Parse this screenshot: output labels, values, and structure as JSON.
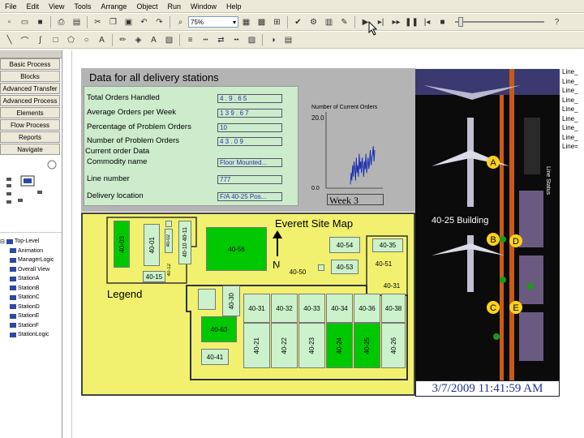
{
  "menu": [
    "File",
    "Edit",
    "View",
    "Tools",
    "Arrange",
    "Object",
    "Run",
    "Window",
    "Help"
  ],
  "toolbar": {
    "zoom_value": "75%"
  },
  "nav_buttons": [
    "Basic Process",
    "Blocks",
    "Advanced Transfer",
    "Advanced Process",
    "Elements",
    "Flow Process",
    "Reports",
    "Navigate"
  ],
  "tree": [
    "Top-Level",
    "Animation",
    "ManagerLogic",
    "Overall View",
    "StationA",
    "StationB",
    "StationC",
    "StationD",
    "StationE",
    "StationF",
    "StationLogic"
  ],
  "panel": {
    "title": "Data for all delivery stations",
    "labels": {
      "total": "Total Orders Handled",
      "avg": "Average Orders per Week",
      "pct": "Percentage of Problem Orders",
      "num": "Number of Problem Orders",
      "current": "Current order Data",
      "commodity": "Commodity name",
      "line": "Line number",
      "location": "Delivery location"
    },
    "values": {
      "total": "4 . 9 . 6 5",
      "avg": "1 3 9 . 6 7",
      "pct": "10",
      "num": "4 3 . 0 9",
      "commodity": "Floor Mounted...",
      "line": "777",
      "location": "F/A 40-25 Pos..."
    }
  },
  "chart": {
    "title": "Number of Current Orders",
    "ymax": "20.0",
    "ymin": "0.0",
    "week_label": "Week 3"
  },
  "chart_data": {
    "type": "line",
    "title": "Number of Current Orders",
    "ylim": [
      0,
      20
    ],
    "values": [
      1,
      4,
      2,
      6,
      3,
      7,
      5,
      2,
      8,
      4,
      6,
      3,
      9,
      5,
      7,
      4,
      8,
      6,
      3,
      7,
      5,
      9,
      4,
      6,
      8,
      5,
      7,
      10,
      6,
      8,
      9,
      11,
      7,
      10
    ]
  },
  "map": {
    "title": "Everett Site Map",
    "north": "N",
    "legend": "Legend",
    "buildings": {
      "b4003": "40-03",
      "b4001": "40-01",
      "b4002": "40-02",
      "b4010": "40-10 40-11",
      "b4012": "40-12",
      "b4015": "40-15",
      "b4056": "40-56",
      "b4054": "40-54",
      "b4035": "40-35",
      "b4053": "40-53",
      "b4051": "40-51",
      "b4050": "40-50",
      "b4031t": "40-31",
      "b4030": "40-30",
      "b4031": "40-31",
      "b4032": "40-32",
      "b4033": "40-33",
      "b4034": "40-34",
      "b4036": "40-36",
      "b4038": "40-38",
      "b4063": "40-63",
      "b4021": "40-21",
      "b4022": "40-22",
      "b4023": "40-23",
      "b4024": "40-24",
      "b4025": "40-25",
      "b4026": "40-26",
      "b4041": "40-41"
    }
  },
  "satellite": {
    "building_label": "40-25 Building",
    "stations": [
      "A",
      "B",
      "D",
      "C",
      "E"
    ],
    "side_text": "Line Status"
  },
  "timestamp": "3/7/2009 11:41:59 AM",
  "right_list": [
    "Line_",
    "Line_",
    "Line_",
    "Line_",
    "Line_",
    "Line_",
    "Line_",
    "Line_",
    "Line="
  ]
}
